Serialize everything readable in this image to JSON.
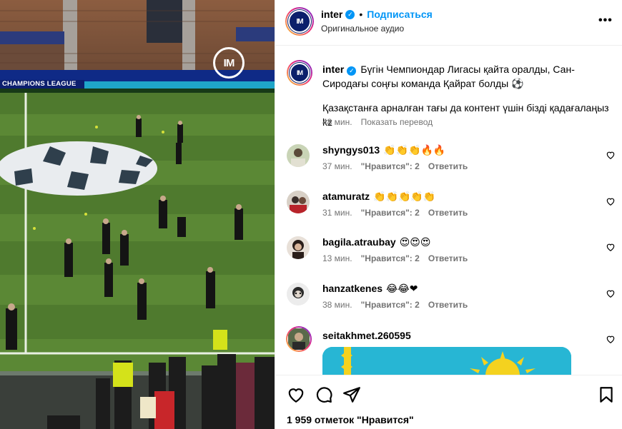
{
  "media": {
    "banner_text": "CHAMPIONS LEAGUE",
    "logo_text": "IM",
    "logo_icon": "inter-logo-watermark"
  },
  "header": {
    "username": "inter",
    "follow_label": "Подписаться",
    "separator": "•",
    "audio_label": "Оригинальное аудио",
    "more_label": "•••",
    "avatar_text": "IM"
  },
  "caption": {
    "username": "inter",
    "text_line1": "Бүгін Чемпиондар Лигасы қайта оралды, Сан-Сиродағы соңғы команда Қайрат болды ⚽",
    "text_line2": "Қазақстанға арналған тағы да контент үшін бізді қадағалаңыз kz",
    "time": "48 мин.",
    "translate_label": "Показать перевод"
  },
  "comments": [
    {
      "username": "shyngys013",
      "text": "👏👏👏🔥🔥",
      "time": "37 мин.",
      "likes_label": "\"Нравится\": 2",
      "reply_label": "Ответить"
    },
    {
      "username": "atamuratz",
      "text": "👏👏👏👏👏",
      "time": "31 мин.",
      "likes_label": "\"Нравится\": 2",
      "reply_label": "Ответить"
    },
    {
      "username": "bagila.atraubay",
      "text": "😍😍😍",
      "time": "13 мин.",
      "likes_label": "\"Нравится\": 2",
      "reply_label": "Ответить"
    },
    {
      "username": "hanzatkenes",
      "text": "😂😂❤",
      "time": "38 мин.",
      "likes_label": "\"Нравится\": 2",
      "reply_label": "Ответить"
    },
    {
      "username": "seitakhmet.260595",
      "text": ""
    }
  ],
  "actions": {
    "likes_text": "1 959 отметок \"Нравится\""
  },
  "colors": {
    "accent": "#0095f6",
    "secondary_text": "#737373",
    "pitch": "#4f7a2e",
    "flag_blue": "#27b6d4",
    "flag_gold": "#f4d21f"
  }
}
